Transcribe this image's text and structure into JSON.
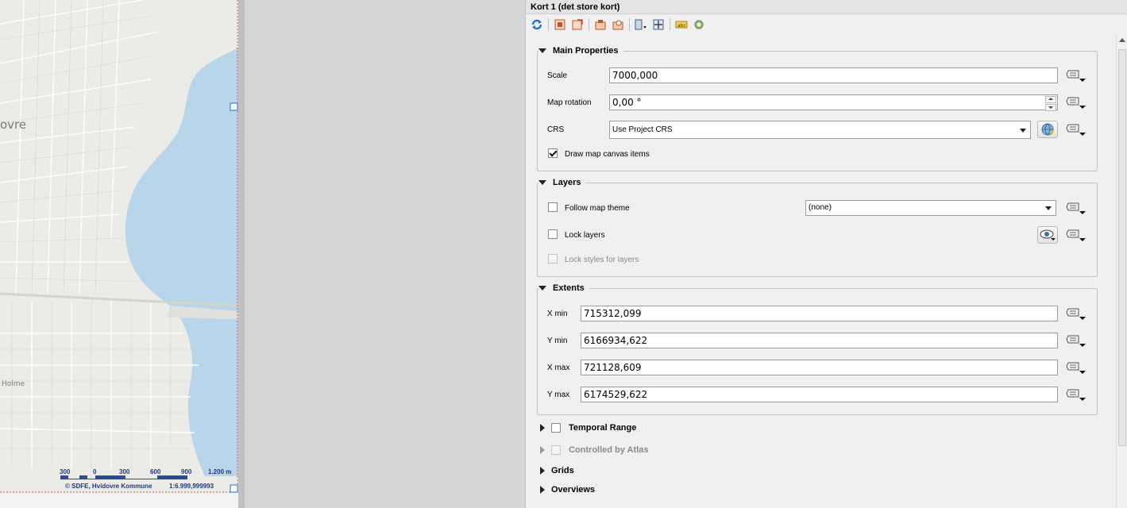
{
  "map": {
    "labels": {
      "town": "ovre",
      "area": "Holme"
    },
    "scalebar": {
      "ticks": [
        "300",
        "0",
        "300",
        "600",
        "900",
        "1.200 m"
      ],
      "credit": "© SDFE, Hvidovre Kommune",
      "ratio": "1:6.999,999993"
    }
  },
  "panel": {
    "title": "Kort 1 (det store kort)",
    "toolbar": [
      "refresh-icon",
      "set-extent-icon",
      "view-extent-icon",
      "set-scale-icon",
      "view-scale-icon",
      "bookmark-icon",
      "move-content-icon",
      "labels-icon",
      "atlas-icon"
    ],
    "main_properties": {
      "title": "Main Properties",
      "scale_label": "Scale",
      "scale_value": "7000,000",
      "rotation_label": "Map rotation",
      "rotation_value": "0,00 °",
      "crs_label": "CRS",
      "crs_value": "Use Project CRS",
      "draw_items_label": "Draw map canvas items",
      "draw_items_checked": true
    },
    "layers": {
      "title": "Layers",
      "follow_theme_label": "Follow map theme",
      "follow_theme_value": "(none)",
      "follow_theme_checked": false,
      "lock_layers_label": "Lock layers",
      "lock_layers_checked": false,
      "lock_styles_label": "Lock styles for layers",
      "lock_styles_checked": false
    },
    "extents": {
      "title": "Extents",
      "xmin_label": "X min",
      "xmin_value": "715312,099",
      "ymin_label": "Y min",
      "ymin_value": "6166934,622",
      "xmax_label": "X max",
      "xmax_value": "721128,609",
      "ymax_label": "Y max",
      "ymax_value": "6174529,622"
    },
    "collapsed": {
      "temporal": "Temporal Range",
      "atlas": "Controlled by Atlas",
      "grids": "Grids",
      "overviews": "Overviews"
    }
  }
}
